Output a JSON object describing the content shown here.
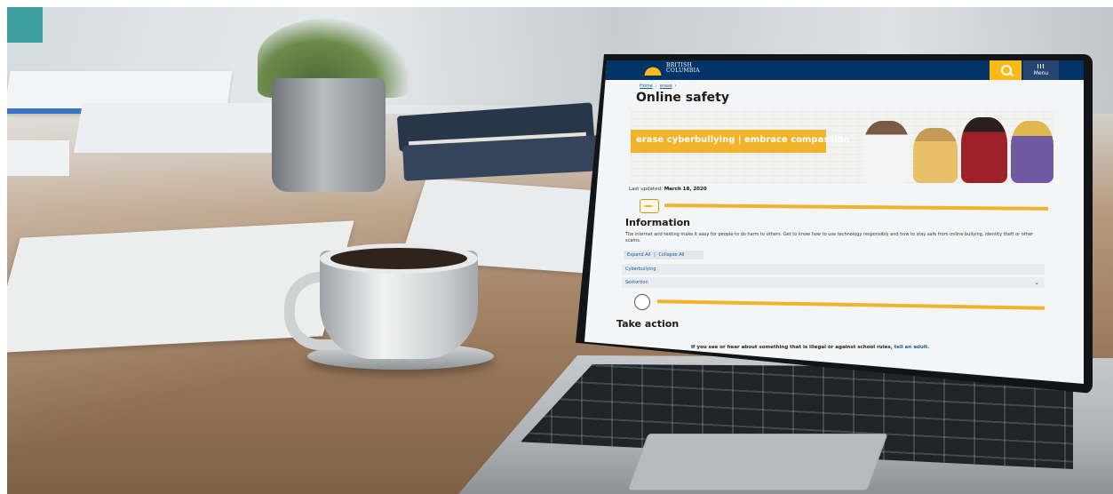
{
  "site": {
    "gov_name_line1": "BRITISH",
    "gov_name_line2": "COLUMBIA",
    "menu_label": "Menu"
  },
  "breadcrumb": {
    "items": [
      "Home",
      "erase"
    ]
  },
  "page": {
    "title": "Online safety",
    "banner_text": "erase cyberbullying | embrace compassion",
    "updated_label": "Last updated:",
    "updated_date": "March 18, 2020"
  },
  "information": {
    "heading": "Information",
    "body": "The internet and texting make it easy for people to do harm to others. Get to know how to use technology responsibly and how to stay safe from online bullying, identity theft or other scams.",
    "expand_all": "Expand All",
    "separator": "|",
    "collapse_all": "Collapse All",
    "accordion": [
      "Cyberbullying",
      "Sextortion"
    ]
  },
  "take_action": {
    "heading": "Take action",
    "text": "If you see or hear about something that is illegal or against school rules,",
    "link": "tell an adult."
  },
  "colors": {
    "teal_square": "#3e9ea0",
    "gov_blue": "#003366",
    "gov_gold": "#fcba19",
    "erase_orange": "#f0b32b"
  }
}
